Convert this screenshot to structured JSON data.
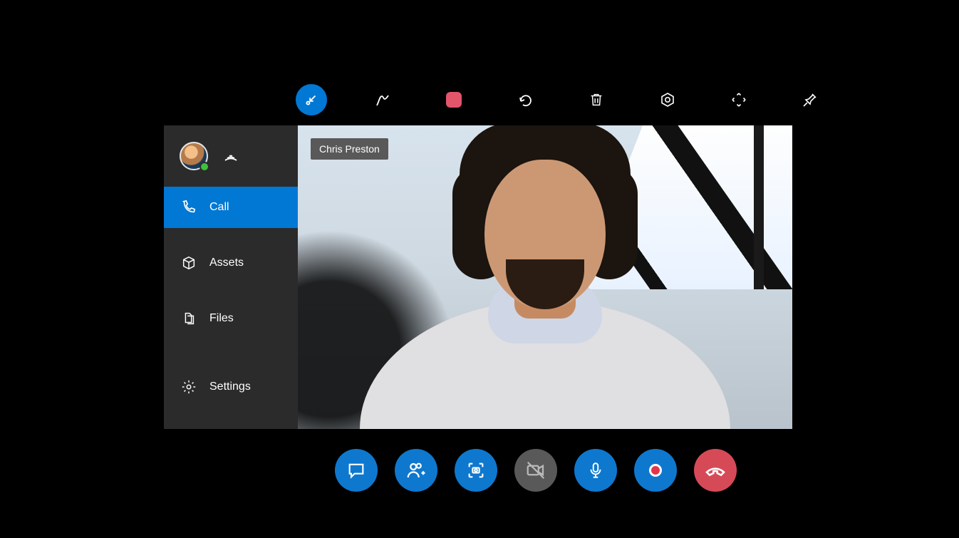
{
  "participant_name": "Chris Preston",
  "colors": {
    "accent": "#0078d4",
    "danger": "#d64a58",
    "muted": "#595959"
  },
  "top_toolbar": {
    "items": [
      {
        "name": "arrow-collapse",
        "active": true
      },
      {
        "name": "ink-pen"
      },
      {
        "name": "red-shape"
      },
      {
        "name": "undo"
      },
      {
        "name": "trash"
      },
      {
        "name": "hololens-settings"
      },
      {
        "name": "move-arrows"
      },
      {
        "name": "pin"
      }
    ]
  },
  "sidebar": {
    "presence": "available",
    "items": [
      {
        "id": "call",
        "label": "Call",
        "icon": "phone-icon",
        "selected": true
      },
      {
        "id": "assets",
        "label": "Assets",
        "icon": "package-icon",
        "selected": false
      },
      {
        "id": "files",
        "label": "Files",
        "icon": "files-icon",
        "selected": false
      },
      {
        "id": "settings",
        "label": "Settings",
        "icon": "gear-icon",
        "selected": false
      }
    ]
  },
  "call_bar": {
    "items": [
      {
        "id": "chat",
        "icon": "chat-icon",
        "style": "blue",
        "enabled": true
      },
      {
        "id": "add-people",
        "icon": "add-person-icon",
        "style": "blue",
        "enabled": true
      },
      {
        "id": "screenshot",
        "icon": "camera-frame-icon",
        "style": "blue",
        "enabled": true
      },
      {
        "id": "video-toggle",
        "icon": "video-off-icon",
        "style": "gray",
        "enabled": true
      },
      {
        "id": "mic-toggle",
        "icon": "microphone-icon",
        "style": "blue",
        "enabled": true
      },
      {
        "id": "record",
        "icon": "record-icon",
        "style": "blue",
        "enabled": true
      },
      {
        "id": "end-call",
        "icon": "hangup-icon",
        "style": "red",
        "enabled": true
      }
    ]
  }
}
